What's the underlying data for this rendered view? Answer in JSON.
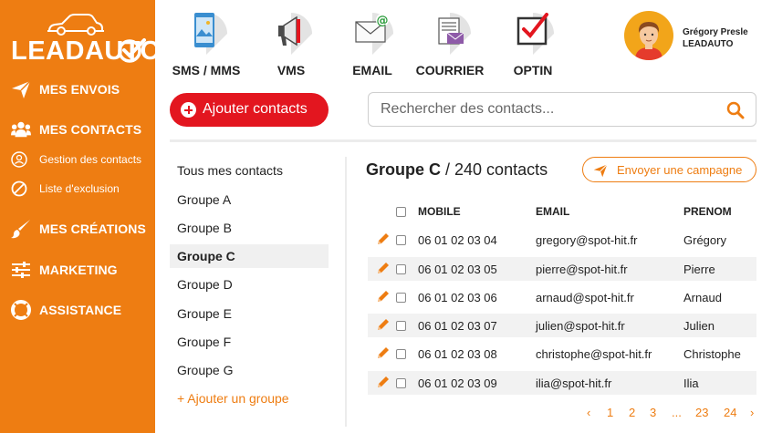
{
  "brand": {
    "logo_text": "LEADAUTO",
    "accent": "#ee7d12",
    "primary_red": "#e3161f"
  },
  "sidebar": {
    "items": [
      {
        "label": "MES ENVOIS",
        "icon": "paper-plane-icon"
      },
      {
        "label": "MES CONTACTS",
        "icon": "users-icon"
      },
      {
        "label": "MES CRÉATIONS",
        "icon": "brush-icon"
      },
      {
        "label": "MARKETING",
        "icon": "sliders-icon"
      },
      {
        "label": "ASSISTANCE",
        "icon": "lifebuoy-icon"
      }
    ],
    "subitems": [
      {
        "label": "Gestion des contacts",
        "icon": "user-circle-icon"
      },
      {
        "label": "Liste d'exclusion",
        "icon": "ban-icon"
      }
    ]
  },
  "channels": [
    {
      "label": "SMS / MMS",
      "icon": "phone-image-icon"
    },
    {
      "label": "VMS",
      "icon": "megaphone-icon"
    },
    {
      "label": "EMAIL",
      "icon": "envelope-at-icon"
    },
    {
      "label": "COURRIER",
      "icon": "letter-icon"
    },
    {
      "label": "OPTIN",
      "icon": "checkbox-icon"
    }
  ],
  "user": {
    "name": "Grégory Presle",
    "company": "LEADAUTO"
  },
  "actions": {
    "add_contacts": "Ajouter contacts",
    "search_placeholder": "Rechercher des contacts...",
    "send_campaign": "Envoyer une campagne",
    "add_group": "+ Ajouter un groupe"
  },
  "groups": [
    "Tous mes contacts",
    "Groupe A",
    "Groupe B",
    "Groupe C",
    "Groupe D",
    "Groupe E",
    "Groupe F",
    "Groupe G"
  ],
  "active_group": "Groupe C",
  "group_header": {
    "name": "Groupe C",
    "count_text": " / 240 contacts"
  },
  "table": {
    "headers": [
      "MOBILE",
      "EMAIL",
      "PRENOM"
    ],
    "rows": [
      {
        "mobile": "06 01 02 03 04",
        "email": "gregory@spot-hit.fr",
        "prenom": "Grégory"
      },
      {
        "mobile": "06 01 02 03 05",
        "email": "pierre@spot-hit.fr",
        "prenom": "Pierre"
      },
      {
        "mobile": "06 01 02 03 06",
        "email": "arnaud@spot-hit.fr",
        "prenom": "Arnaud"
      },
      {
        "mobile": "06 01 02 03 07",
        "email": "julien@spot-hit.fr",
        "prenom": "Julien"
      },
      {
        "mobile": "06 01 02 03 08",
        "email": "christophe@spot-hit.fr",
        "prenom": "Christophe"
      },
      {
        "mobile": "06 01 02 03 09",
        "email": "ilia@spot-hit.fr",
        "prenom": "Ilia"
      }
    ]
  },
  "pagination": [
    "‹",
    "1",
    "2",
    "3",
    "...",
    "23",
    "24",
    "›"
  ]
}
